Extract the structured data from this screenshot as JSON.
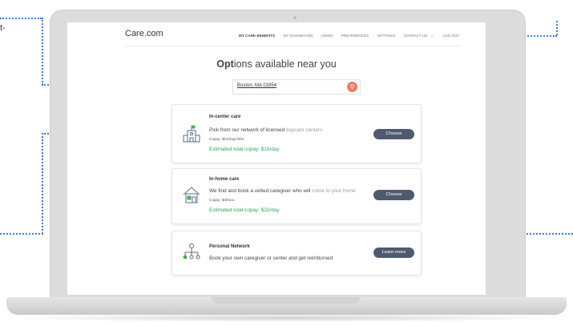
{
  "header": {
    "logo": "Care.com",
    "nav": [
      "MY CARE BENEFITS",
      "MY DASHBOARD",
      "ADMIN",
      "PREFERENCES",
      "SETTINGS",
      "CONTACT US",
      "LOG OUT"
    ]
  },
  "page_title": {
    "bold": "Opt",
    "rest": "ions available near you"
  },
  "search": {
    "value": "Boston, MA 01854"
  },
  "cards": [
    {
      "title": "In-center care",
      "desc_main": "Pick from our network of licensed",
      "desc_muted": " daycare centers",
      "detail": "Copay: $10/day/child.",
      "copay": "Estimated total copay: $10/day.",
      "button": "Choose",
      "icon": "school-building-icon"
    },
    {
      "title": "In-home care",
      "desc_main": "We find and book a vetted caregiver who will",
      "desc_muted": " come to your home",
      "detail": "Copay: $4/hour.",
      "copay": "Estimated total copay: $32/day.",
      "button": "Choose",
      "icon": "house-icon"
    },
    {
      "title": "Personal Network",
      "desc_main": "Book your own caregiver or center and get reimbursed",
      "desc_muted": "",
      "button": "Learn more",
      "icon": "network-icon"
    }
  ],
  "margin_text": "t-",
  "colors": {
    "accent": "#f07a5f",
    "button": "#4f5a6e",
    "copay": "#33a35a",
    "callout": "#3f7fd6"
  }
}
